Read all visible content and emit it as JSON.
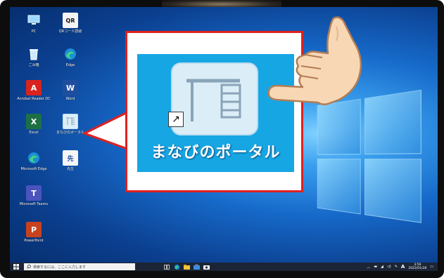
{
  "desktop": {
    "icons": [
      {
        "label": "PC",
        "icon": "pc-icon"
      },
      {
        "label": "QRコード読取",
        "icon": "qr-icon"
      },
      {
        "label": "ごみ箱",
        "icon": "recycle-bin-icon"
      },
      {
        "label": "Edge",
        "icon": "edge-icon"
      },
      {
        "label": "Acrobat Reader DC",
        "icon": "acrobat-icon"
      },
      {
        "label": "Word",
        "icon": "word-icon"
      },
      {
        "label": "Excel",
        "icon": "excel-icon"
      },
      {
        "label": "まなびのポータル",
        "icon": "portal-icon"
      },
      {
        "label": "Microsoft Edge",
        "icon": "edge-icon"
      },
      {
        "label": "先生",
        "icon": "sensei-icon"
      },
      {
        "label": "Microsoft Teams",
        "icon": "teams-icon"
      },
      {
        "label": "PowerPoint",
        "icon": "powerpoint-icon"
      }
    ]
  },
  "callout": {
    "app_name": "まなびのポータル",
    "shortcut_glyph": "↗"
  },
  "taskbar": {
    "search_placeholder": "検索するには、ここに入力します",
    "ime": "A",
    "time": "3:59",
    "date": "2022/01/28"
  },
  "colors": {
    "accent_red": "#e02020",
    "callout_bg": "#17a6e4",
    "taskbar_bg": "#1c2535"
  }
}
